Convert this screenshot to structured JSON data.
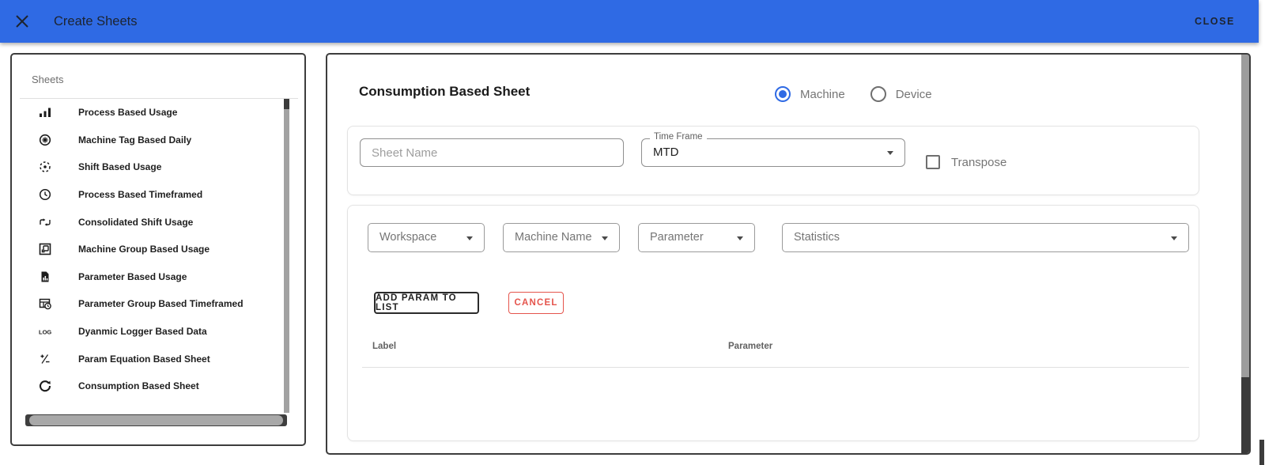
{
  "header": {
    "title": "Create Sheets",
    "close_label": "CLOSE"
  },
  "sidebar": {
    "title": "Sheets",
    "items": [
      {
        "label": "Process Based Usage",
        "icon": "bar-chart-icon"
      },
      {
        "label": "Machine Tag Based Daily",
        "icon": "gear-circle-icon"
      },
      {
        "label": "Shift Based Usage",
        "icon": "dashed-circle-icon"
      },
      {
        "label": "Process Based Timeframed",
        "icon": "clock-icon"
      },
      {
        "label": "Consolidated Shift Usage",
        "icon": "shift-arrows-icon"
      },
      {
        "label": "Machine Group Based Usage",
        "icon": "nested-squares-icon"
      },
      {
        "label": "Parameter Based Usage",
        "icon": "doc-chart-icon"
      },
      {
        "label": "Parameter Group Based Timeframed",
        "icon": "table-clock-icon"
      },
      {
        "label": "Dyanmic Logger Based Data",
        "icon": "log-text-icon"
      },
      {
        "label": "Param Equation Based Sheet",
        "icon": "plus-minus-icon"
      },
      {
        "label": "Consumption Based Sheet",
        "icon": "rotate-icon"
      }
    ]
  },
  "main": {
    "heading": "Consumption Based Sheet",
    "entity_toggle": {
      "options": [
        {
          "label": "Machine",
          "selected": true
        },
        {
          "label": "Device",
          "selected": false
        }
      ]
    },
    "form": {
      "sheet_name": {
        "placeholder": "Sheet Name",
        "value": ""
      },
      "time_frame": {
        "label": "Time Frame",
        "value": "MTD"
      },
      "transpose": {
        "label": "Transpose",
        "checked": false
      }
    },
    "param_form": {
      "dropdowns": [
        {
          "label": "Workspace"
        },
        {
          "label": "Machine Name"
        },
        {
          "label": "Parameter"
        },
        {
          "label": "Statistics"
        }
      ],
      "add_button": "ADD PARAM TO LIST",
      "cancel_button": "CANCEL",
      "table": {
        "columns": [
          "Label",
          "Parameter"
        ],
        "rows": []
      }
    }
  },
  "colors": {
    "header_bg": "#2f6ae4",
    "accent_blue": "#2f6ae4",
    "cancel_red": "#e5544c"
  }
}
